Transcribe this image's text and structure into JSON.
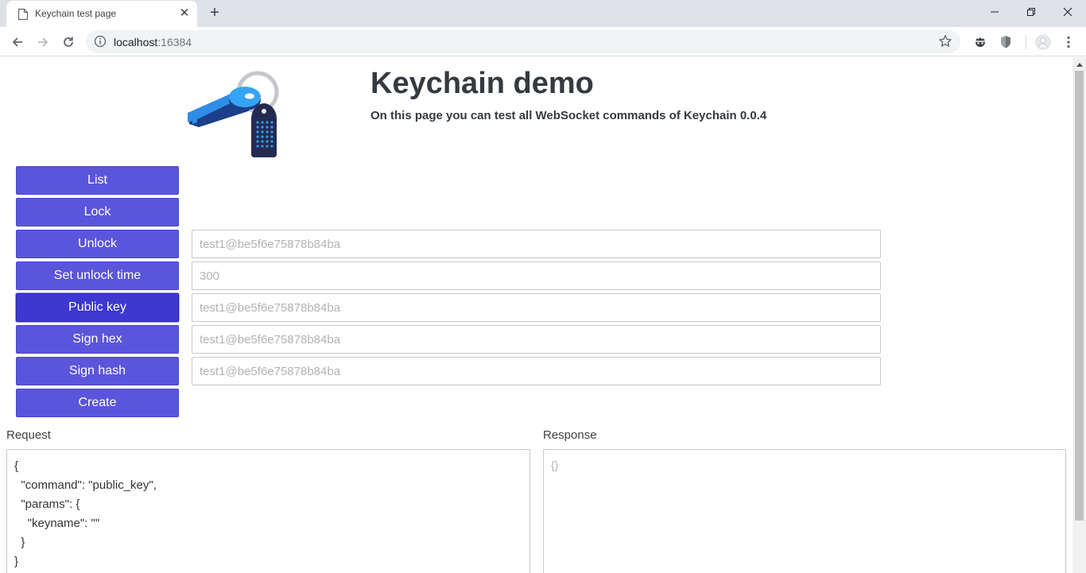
{
  "browser": {
    "tab_title": "Keychain test page",
    "tab_close": "✕",
    "new_tab": "+",
    "url_host": "localhost",
    "url_port": ":16384"
  },
  "icons": [
    "page-icon",
    "close-icon",
    "plus-icon",
    "minimize-icon",
    "restore-icon",
    "back-icon",
    "forward-icon",
    "reload-icon",
    "info-icon",
    "star-icon",
    "extension-icon",
    "shield-icon",
    "profile-icon",
    "menu-icon",
    "key-logo"
  ],
  "colors": {
    "button": "#5b55db",
    "button_active": "#3e37d1",
    "heading": "#343a40"
  },
  "header": {
    "title": "Keychain demo",
    "subtitle": "On this page you can test all WebSocket commands of Keychain 0.0.4"
  },
  "commands": {
    "list": "List",
    "lock": "Lock",
    "unlock": "Unlock",
    "set_unlock_time": "Set unlock time",
    "public_key": "Public key",
    "sign_hex": "Sign hex",
    "sign_hash": "Sign hash",
    "create": "Create"
  },
  "inputs": {
    "unlock_placeholder": "test1@be5f6e75878b84ba",
    "unlock_time_placeholder": "300",
    "public_key_placeholder": "test1@be5f6e75878b84ba",
    "sign_hex_placeholder": "test1@be5f6e75878b84ba",
    "sign_hash_placeholder": "test1@be5f6e75878b84ba"
  },
  "request": {
    "label": "Request",
    "body": "{\n  \"command\": \"public_key\",\n  \"params\": {\n    \"keyname\": \"\"\n  }\n}"
  },
  "response": {
    "label": "Response",
    "body": "{}"
  }
}
